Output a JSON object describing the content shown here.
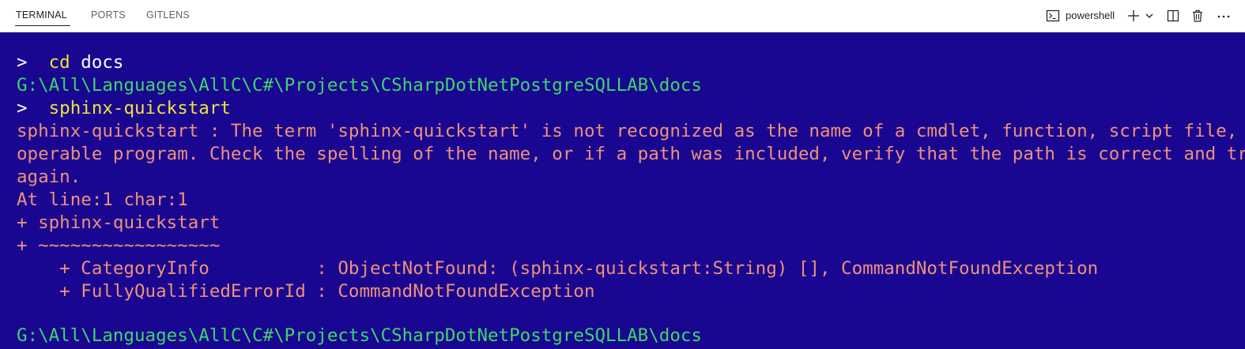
{
  "panel": {
    "tabs": [
      {
        "label": "TERMINAL",
        "active": true
      },
      {
        "label": "PORTS",
        "active": false
      },
      {
        "label": "GITLENS",
        "active": false
      }
    ],
    "toolbar": {
      "profile_label": "powershell",
      "icons": [
        "terminal-icon",
        "plus-icon",
        "chevron-down-icon",
        "split-icon",
        "trash-icon",
        "ellipsis-icon"
      ]
    }
  },
  "terminal": {
    "colors": {
      "background": "#1a0791",
      "command": "#f0e23a",
      "argument": "#ffffff",
      "path": "#3dd66b",
      "error": "#f0907a"
    },
    "lines": {
      "l1_prompt": ">  ",
      "l1_cmd": "cd",
      "l1_arg": " docs",
      "l2_path": "G:\\All\\Languages\\AllC\\C#\\Projects\\CSharpDotNetPostgreSQLLAB\\docs",
      "l3_prompt": ">  ",
      "l3_cmd": "sphinx-quickstart",
      "l4_err": "sphinx-quickstart : The term 'sphinx-quickstart' is not recognized as the name of a cmdlet, function, script file, or",
      "l5_err": "operable program. Check the spelling of the name, or if a path was included, verify that the path is correct and try",
      "l6_err": "again.",
      "l7_err": "At line:1 char:1",
      "l8_err": "+ sphinx-quickstart",
      "l9_err": "+ ~~~~~~~~~~~~~~~~~",
      "l10_err": "    + CategoryInfo          : ObjectNotFound: (sphinx-quickstart:String) [], CommandNotFoundException",
      "l11_err": "    + FullyQualifiedErrorId : CommandNotFoundException",
      "l13_path": "G:\\All\\Languages\\AllC\\C#\\Projects\\CSharpDotNetPostgreSQLLAB\\docs"
    }
  }
}
